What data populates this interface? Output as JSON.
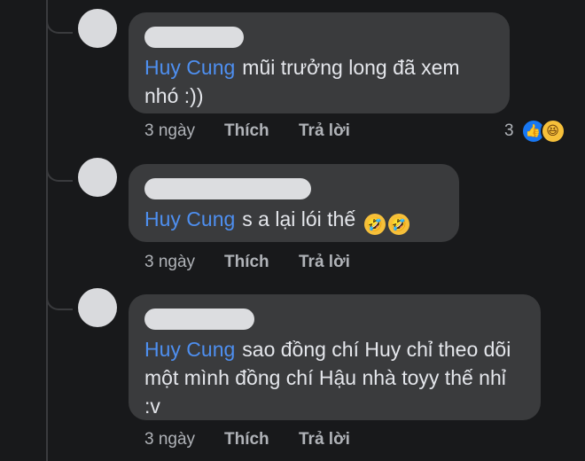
{
  "comments": [
    {
      "mention": "Huy Cung",
      "text": "mũi trưởng long đã xem nhó :))",
      "time": "3 ngày",
      "like_label": "Thích",
      "reply_label": "Trả lời",
      "reaction_count": "3",
      "reactions": [
        "like-icon",
        "haha-icon"
      ]
    },
    {
      "mention": "Huy Cung",
      "text": "s a lại lói thế",
      "emojis": [
        "rofl-icon",
        "rofl-icon"
      ],
      "time": "3 ngày",
      "like_label": "Thích",
      "reply_label": "Trả lời"
    },
    {
      "mention": "Huy Cung",
      "text": "sao đồng chí Huy chỉ theo dõi một mình đồng chí Hậu nhà toyy thế nhỉ :v",
      "time": "3 ngày",
      "like_label": "Thích",
      "reply_label": "Trả lời"
    }
  ]
}
